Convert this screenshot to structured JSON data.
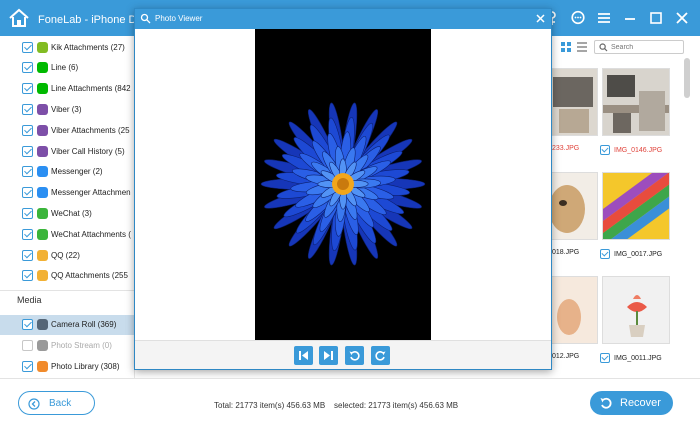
{
  "app": {
    "title": "FoneLab - iPhone Da"
  },
  "sidebar": {
    "items": [
      {
        "label": "Kik Attachments (27)",
        "icon": "kik-icon",
        "color": "#82bc23",
        "checked": true
      },
      {
        "label": "Line (6)",
        "icon": "line-icon",
        "color": "#00b900",
        "checked": true
      },
      {
        "label": "Line Attachments (842",
        "icon": "line-icon",
        "color": "#00b900",
        "checked": true
      },
      {
        "label": "Viber (3)",
        "icon": "viber-icon",
        "color": "#7d4fa8",
        "checked": true
      },
      {
        "label": "Viber Attachments (25",
        "icon": "viber-icon",
        "color": "#7d4fa8",
        "checked": true
      },
      {
        "label": "Viber Call History (5)",
        "icon": "viber-icon",
        "color": "#7d4fa8",
        "checked": true
      },
      {
        "label": "Messenger (2)",
        "icon": "messenger-icon",
        "color": "#2b8ff2",
        "checked": true
      },
      {
        "label": "Messenger Attachmen",
        "icon": "messenger-icon",
        "color": "#2b8ff2",
        "checked": true
      },
      {
        "label": "WeChat (3)",
        "icon": "wechat-icon",
        "color": "#3bb53b",
        "checked": true
      },
      {
        "label": "WeChat Attachments (",
        "icon": "wechat-icon",
        "color": "#3bb53b",
        "checked": true
      },
      {
        "label": "QQ (22)",
        "icon": "qq-icon",
        "color": "#f2b134",
        "checked": true
      },
      {
        "label": "QQ Attachments (255",
        "icon": "qq-icon",
        "color": "#f2b134",
        "checked": true
      }
    ],
    "media_title": "Media",
    "media_items": [
      {
        "label": "Camera Roll (369)",
        "icon": "camera-icon",
        "color": "#556677",
        "checked": true,
        "selected": true
      },
      {
        "label": "Photo Stream (0)",
        "icon": "photo-stream-icon",
        "color": "#9a9a9a",
        "checked": false,
        "disabled": true
      },
      {
        "label": "Photo Library (308)",
        "icon": "photos-icon",
        "color": "#f18b2c",
        "checked": true
      }
    ]
  },
  "search": {
    "placeholder": "Search"
  },
  "thumbnails": [
    {
      "label": "233.JPG",
      "red": true
    },
    {
      "label": "IMG_0146.JPG",
      "red": true
    },
    {
      "label": "018.JPG",
      "red": false
    },
    {
      "label": "IMG_0017.JPG",
      "red": false
    },
    {
      "label": "012.JPG",
      "red": false
    },
    {
      "label": "IMG_0011.JPG",
      "red": false
    }
  ],
  "viewer": {
    "title": "Photo Viewer"
  },
  "footer": {
    "back_label": "Back",
    "status": "Total: 21773 item(s) 456.63 MB    selected: 21773 item(s) 456.63 MB",
    "recover_label": "Recover"
  },
  "colors": {
    "accent": "#3a9ad9",
    "flower": "#1f4fd8",
    "flower_center": "#f2a61c"
  }
}
